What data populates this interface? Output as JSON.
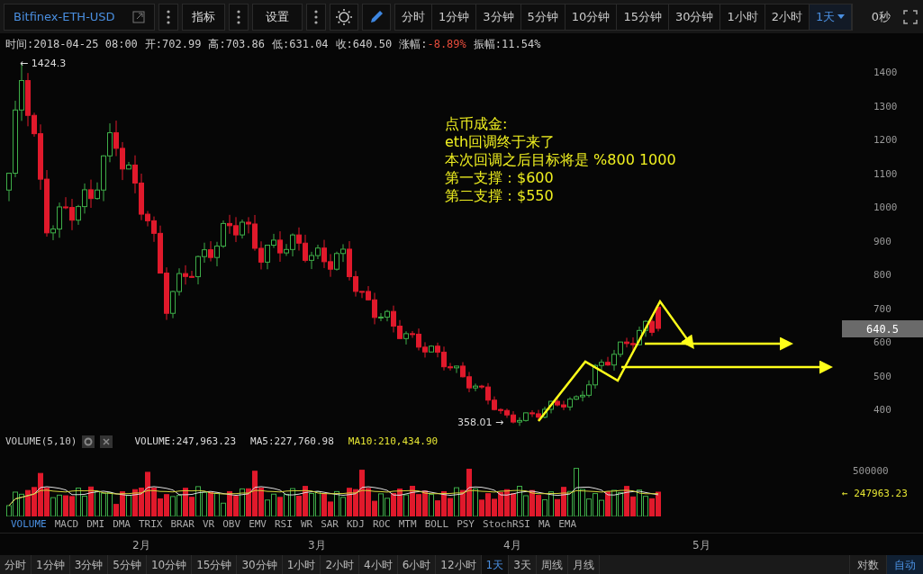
{
  "toolbar": {
    "symbol": "Bitfinex-ETH-USD",
    "indicators_button": "指标",
    "settings_button": "设置",
    "periods": [
      {
        "label": "分时",
        "selected": false
      },
      {
        "label": "1分钟",
        "selected": false
      },
      {
        "label": "3分钟",
        "selected": false
      },
      {
        "label": "5分钟",
        "selected": false
      },
      {
        "label": "10分钟",
        "selected": false
      },
      {
        "label": "15分钟",
        "selected": false
      },
      {
        "label": "30分钟",
        "selected": false
      },
      {
        "label": "1小时",
        "selected": false
      },
      {
        "label": "2小时",
        "selected": false
      },
      {
        "label": "1天",
        "selected": true
      }
    ],
    "countdown": "0秒"
  },
  "info": [
    {
      "label": "时间:",
      "value": "2018-04-25 08:00",
      "color": "#cccccc"
    },
    {
      "label": "开:",
      "value": "702.99",
      "color": "#cccccc"
    },
    {
      "label": "高:",
      "value": "703.86",
      "color": "#cccccc"
    },
    {
      "label": "低:",
      "value": "631.04",
      "color": "#cccccc"
    },
    {
      "label": "收:",
      "value": "640.50",
      "color": "#cccccc"
    },
    {
      "label": "涨幅:",
      "value": "-8.89%",
      "color": "#e74c3c"
    },
    {
      "label": "振幅:",
      "value": "11.54%",
      "color": "#cccccc"
    }
  ],
  "main_chart": {
    "high_label": "← 1424.3",
    "low_label": "358.01 →",
    "annotation": [
      "点币成金:",
      "eth回调终于来了",
      "本次回调之后目标将是 %800 1000",
      "第一支撑：$600",
      "第二支撑：$550"
    ],
    "y_labels": [
      "1400",
      "1300",
      "1200",
      "1100",
      "1000",
      "900",
      "800",
      "700",
      "600",
      "500",
      "400"
    ],
    "last_price": "640.5"
  },
  "volume": {
    "title": "VOLUME(5,10)",
    "readings": [
      {
        "text": "VOLUME:247,963.23",
        "color": "#dddddd"
      },
      {
        "text": "MA5:227,760.98",
        "color": "#dddddd"
      },
      {
        "text": "MA10:210,434.90",
        "color": "#e6e633"
      }
    ],
    "y_label": "500000",
    "last_value": "← 247963.23"
  },
  "indicator_tabs": [
    {
      "label": "VOLUME",
      "selected": true
    },
    {
      "label": "MACD",
      "selected": false
    },
    {
      "label": "DMI",
      "selected": false
    },
    {
      "label": "DMA",
      "selected": false
    },
    {
      "label": "TRIX",
      "selected": false
    },
    {
      "label": "BRAR",
      "selected": false
    },
    {
      "label": "VR",
      "selected": false
    },
    {
      "label": "OBV",
      "selected": false
    },
    {
      "label": "EMV",
      "selected": false
    },
    {
      "label": "RSI",
      "selected": false
    },
    {
      "label": "WR",
      "selected": false
    },
    {
      "label": "SAR",
      "selected": false
    },
    {
      "label": "KDJ",
      "selected": false
    },
    {
      "label": "ROC",
      "selected": false
    },
    {
      "label": "MTM",
      "selected": false
    },
    {
      "label": "BOLL",
      "selected": false
    },
    {
      "label": "PSY",
      "selected": false
    },
    {
      "label": "StochRSI",
      "selected": false
    },
    {
      "label": "MA",
      "selected": false
    },
    {
      "label": "EMA",
      "selected": false
    }
  ],
  "months": [
    "2月",
    "3月",
    "4月",
    "5月"
  ],
  "bottom_periods": [
    {
      "label": "分时",
      "selected": false
    },
    {
      "label": "1分钟",
      "selected": false
    },
    {
      "label": "3分钟",
      "selected": false
    },
    {
      "label": "5分钟",
      "selected": false
    },
    {
      "label": "10分钟",
      "selected": false
    },
    {
      "label": "15分钟",
      "selected": false
    },
    {
      "label": "30分钟",
      "selected": false
    },
    {
      "label": "1小时",
      "selected": false
    },
    {
      "label": "2小时",
      "selected": false
    },
    {
      "label": "4小时",
      "selected": false
    },
    {
      "label": "6小时",
      "selected": false
    },
    {
      "label": "12小时",
      "selected": false
    },
    {
      "label": "1天",
      "selected": true
    },
    {
      "label": "3天",
      "selected": false
    },
    {
      "label": "周线",
      "selected": false
    },
    {
      "label": "月线",
      "selected": false
    }
  ],
  "scale_modes": [
    {
      "label": "对数",
      "selected": false
    },
    {
      "label": "自动",
      "selected": true
    }
  ]
}
